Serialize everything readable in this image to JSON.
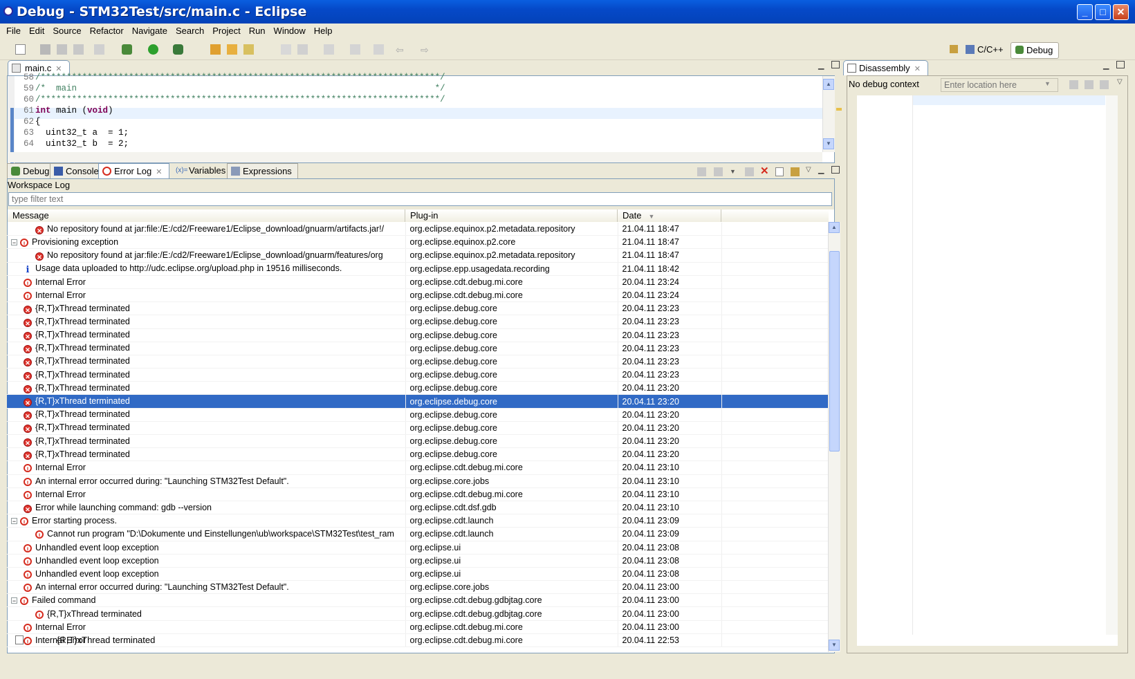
{
  "window": {
    "title": "Debug - STM32Test/src/main.c - Eclipse"
  },
  "menu": [
    "File",
    "Edit",
    "Source",
    "Refactor",
    "Navigate",
    "Search",
    "Project",
    "Run",
    "Window",
    "Help"
  ],
  "perspectives": {
    "cpp": "C/C++",
    "debug": "Debug"
  },
  "editor": {
    "tab": "main.c",
    "lines": [
      {
        "n": "58",
        "text": "/*****************************************************************************/"
      },
      {
        "n": "59",
        "text": "/*  main                                                                     */"
      },
      {
        "n": "60",
        "text": "/*****************************************************************************/"
      },
      {
        "n": "61",
        "kw1": "int",
        "rest1": " main (",
        "kw2": "void",
        "rest2": ")"
      },
      {
        "n": "62",
        "text": "{"
      },
      {
        "n": "63",
        "text": "  uint32_t a  = 1;"
      },
      {
        "n": "64",
        "text": "  uint32_t b  = 2;"
      }
    ]
  },
  "disassembly": {
    "tab": "Disassembly",
    "context": "No debug context",
    "location_placeholder": "Enter location here"
  },
  "bottom_tabs": [
    "Debug",
    "Console",
    "Error Log",
    "Variables",
    "Expressions"
  ],
  "errorlog": {
    "title": "Workspace Log",
    "filter_placeholder": "type filter text",
    "columns": [
      "Message",
      "Plug-in",
      "Date"
    ],
    "rows": [
      {
        "indent": 1,
        "icon": "error",
        "tw": "",
        "msg": "No repository found at jar:file:/E:/cd2/Freeware1/Eclipse_download/gnuarm/artifacts.jar!/",
        "plugin": "org.eclipse.equinox.p2.metadata.repository",
        "date": "21.04.11 18:47"
      },
      {
        "indent": 0,
        "icon": "error-stack",
        "tw": "−",
        "msg": "Provisioning exception",
        "plugin": "org.eclipse.equinox.p2.core",
        "date": "21.04.11 18:47"
      },
      {
        "indent": 1,
        "icon": "error",
        "tw": "",
        "msg": "No repository found at jar:file:/E:/cd2/Freeware1/Eclipse_download/gnuarm/features/org",
        "plugin": "org.eclipse.equinox.p2.metadata.repository",
        "date": "21.04.11 18:47"
      },
      {
        "indent": 0,
        "icon": "info",
        "tw": "",
        "msg": "Usage data uploaded to http://udc.eclipse.org/upload.php in 19516 milliseconds.",
        "plugin": "org.eclipse.epp.usagedata.recording",
        "date": "21.04.11 18:42"
      },
      {
        "indent": 0,
        "icon": "error-stack",
        "tw": "",
        "msg": "Internal Error",
        "plugin": "org.eclipse.cdt.debug.mi.core",
        "date": "20.04.11 23:24"
      },
      {
        "indent": 0,
        "icon": "error-stack",
        "tw": "",
        "msg": "Internal Error",
        "plugin": "org.eclipse.cdt.debug.mi.core",
        "date": "20.04.11 23:24"
      },
      {
        "indent": 0,
        "icon": "error",
        "tw": "",
        "msg": "{R,T}xThread terminated",
        "plugin": "org.eclipse.debug.core",
        "date": "20.04.11 23:23"
      },
      {
        "indent": 0,
        "icon": "error",
        "tw": "",
        "msg": "{R,T}xThread terminated",
        "plugin": "org.eclipse.debug.core",
        "date": "20.04.11 23:23"
      },
      {
        "indent": 0,
        "icon": "error",
        "tw": "",
        "msg": "{R,T}xThread terminated",
        "plugin": "org.eclipse.debug.core",
        "date": "20.04.11 23:23"
      },
      {
        "indent": 0,
        "icon": "error",
        "tw": "",
        "msg": "{R,T}xThread terminated",
        "plugin": "org.eclipse.debug.core",
        "date": "20.04.11 23:23"
      },
      {
        "indent": 0,
        "icon": "error",
        "tw": "",
        "msg": "{R,T}xThread terminated",
        "plugin": "org.eclipse.debug.core",
        "date": "20.04.11 23:23"
      },
      {
        "indent": 0,
        "icon": "error",
        "tw": "",
        "msg": "{R,T}xThread terminated",
        "plugin": "org.eclipse.debug.core",
        "date": "20.04.11 23:23"
      },
      {
        "indent": 0,
        "icon": "error",
        "tw": "",
        "msg": "{R,T}xThread terminated",
        "plugin": "org.eclipse.debug.core",
        "date": "20.04.11 23:20"
      },
      {
        "indent": 0,
        "icon": "error",
        "tw": "",
        "msg": "{R,T}xThread terminated",
        "plugin": "org.eclipse.debug.core",
        "date": "20.04.11 23:20",
        "selected": true
      },
      {
        "indent": 0,
        "icon": "error",
        "tw": "",
        "msg": "{R,T}xThread terminated",
        "plugin": "org.eclipse.debug.core",
        "date": "20.04.11 23:20"
      },
      {
        "indent": 0,
        "icon": "error",
        "tw": "",
        "msg": "{R,T}xThread terminated",
        "plugin": "org.eclipse.debug.core",
        "date": "20.04.11 23:20"
      },
      {
        "indent": 0,
        "icon": "error",
        "tw": "",
        "msg": "{R,T}xThread terminated",
        "plugin": "org.eclipse.debug.core",
        "date": "20.04.11 23:20"
      },
      {
        "indent": 0,
        "icon": "error",
        "tw": "",
        "msg": "{R,T}xThread terminated",
        "plugin": "org.eclipse.debug.core",
        "date": "20.04.11 23:20"
      },
      {
        "indent": 0,
        "icon": "error-stack",
        "tw": "",
        "msg": "Internal Error",
        "plugin": "org.eclipse.cdt.debug.mi.core",
        "date": "20.04.11 23:10"
      },
      {
        "indent": 0,
        "icon": "error-stack",
        "tw": "",
        "msg": "An internal error occurred during: \"Launching STM32Test Default\".",
        "plugin": "org.eclipse.core.jobs",
        "date": "20.04.11 23:10"
      },
      {
        "indent": 0,
        "icon": "error-stack",
        "tw": "",
        "msg": "Internal Error",
        "plugin": "org.eclipse.cdt.debug.mi.core",
        "date": "20.04.11 23:10"
      },
      {
        "indent": 0,
        "icon": "error",
        "tw": "",
        "msg": "Error while launching command: gdb --version",
        "plugin": "org.eclipse.cdt.dsf.gdb",
        "date": "20.04.11 23:10"
      },
      {
        "indent": 0,
        "icon": "error-stack",
        "tw": "−",
        "msg": "Error starting process.",
        "plugin": "org.eclipse.cdt.launch",
        "date": "20.04.11 23:09"
      },
      {
        "indent": 1,
        "icon": "error-stack",
        "tw": "",
        "msg": "Cannot run program \"D:\\Dokumente und Einstellungen\\ub\\workspace\\STM32Test\\test_ram",
        "plugin": "org.eclipse.cdt.launch",
        "date": "20.04.11 23:09"
      },
      {
        "indent": 0,
        "icon": "error-stack",
        "tw": "",
        "msg": "Unhandled event loop exception",
        "plugin": "org.eclipse.ui",
        "date": "20.04.11 23:08"
      },
      {
        "indent": 0,
        "icon": "error-stack",
        "tw": "",
        "msg": "Unhandled event loop exception",
        "plugin": "org.eclipse.ui",
        "date": "20.04.11 23:08"
      },
      {
        "indent": 0,
        "icon": "error-stack",
        "tw": "",
        "msg": "Unhandled event loop exception",
        "plugin": "org.eclipse.ui",
        "date": "20.04.11 23:08"
      },
      {
        "indent": 0,
        "icon": "error-stack",
        "tw": "",
        "msg": "An internal error occurred during: \"Launching STM32Test Default\".",
        "plugin": "org.eclipse.core.jobs",
        "date": "20.04.11 23:00"
      },
      {
        "indent": 0,
        "icon": "error-stack",
        "tw": "−",
        "msg": "Failed command",
        "plugin": "org.eclipse.cdt.debug.gdbjtag.core",
        "date": "20.04.11 23:00"
      },
      {
        "indent": 1,
        "icon": "error-stack",
        "tw": "",
        "msg": "{R,T}xThread terminated",
        "plugin": "org.eclipse.cdt.debug.gdbjtag.core",
        "date": "20.04.11 23:00"
      },
      {
        "indent": 0,
        "icon": "error-stack",
        "tw": "",
        "msg": "Internal Error",
        "plugin": "org.eclipse.cdt.debug.mi.core",
        "date": "20.04.11 23:00"
      },
      {
        "indent": 0,
        "icon": "error-stack",
        "tw": "",
        "msg": "Internal Error",
        "plugin": "org.eclipse.cdt.debug.mi.core",
        "date": "20.04.11 22:53"
      }
    ]
  },
  "status": {
    "message": "{R,T}xThread terminated"
  },
  "colors": {
    "selection": "#316ac5",
    "titlebar": "#0549c8",
    "error": "#e0362e"
  }
}
